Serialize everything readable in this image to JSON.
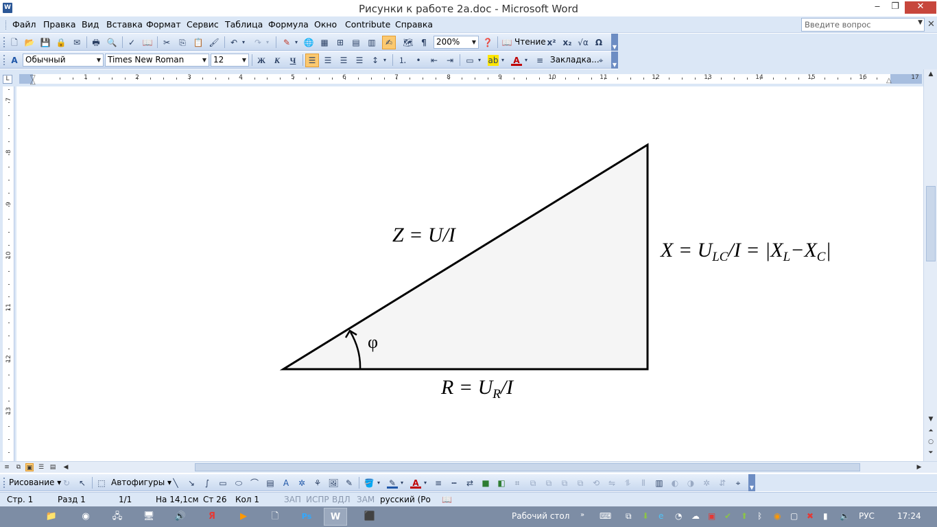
{
  "window": {
    "title": "Рисунки к работе 2а.doc - Microsoft Word",
    "app_icon_letter": "W",
    "min": "‒",
    "restore": "❐",
    "close": "✕"
  },
  "menu": {
    "items": [
      "Файл",
      "Правка",
      "Вид",
      "Вставка",
      "Формат",
      "Сервис",
      "Таблица",
      "Формула",
      "Окно",
      "Contribute",
      "Справка"
    ],
    "help_placeholder": "Введите вопрос",
    "doc_close": "✕"
  },
  "standard_toolbar": {
    "zoom": "200%",
    "reading_label": "Чтение"
  },
  "format_toolbar": {
    "style": "Обычный",
    "font": "Times New Roman",
    "size": "12",
    "bold": "Ж",
    "italic": "К",
    "underline": "Ч",
    "bookmark_label": "Закладка..."
  },
  "ruler": {
    "h_numbers": [
      "1",
      "2",
      "3",
      "4",
      "5",
      "6",
      "7",
      "8",
      "9",
      "10",
      "11",
      "12",
      "13",
      "14",
      "15",
      "16",
      "17"
    ],
    "v_numbers": [
      "7",
      "8",
      "9",
      "10",
      "11",
      "12",
      "13"
    ]
  },
  "document": {
    "hyp": {
      "main": "Z = U/I"
    },
    "vert": {
      "a": "X = U",
      "a_sub": "LC",
      "b": "/I = |X",
      "b_sub": "L",
      "c": "−X",
      "c_sub": "C",
      "d": "|"
    },
    "base": {
      "a": "R = U",
      "a_sub": "R",
      "b": "/I"
    },
    "angle": "φ"
  },
  "drawing_toolbar": {
    "draw_label": "Рисование",
    "autoshapes_label": "Автофигуры"
  },
  "status": {
    "page": "Стр.  1",
    "section": "Разд  1",
    "pages": "1/1",
    "at": "На 14,1см",
    "line": "Ст  26",
    "col": "Кол  1",
    "rec": "ЗАП",
    "trk": "ИСПР",
    "ext": "ВДЛ",
    "ovr": "ЗАМ",
    "lang": "русский (Ро"
  },
  "taskbar": {
    "desktop_label": "Рабочий стол",
    "lang": "РУС",
    "time": "17:24"
  }
}
